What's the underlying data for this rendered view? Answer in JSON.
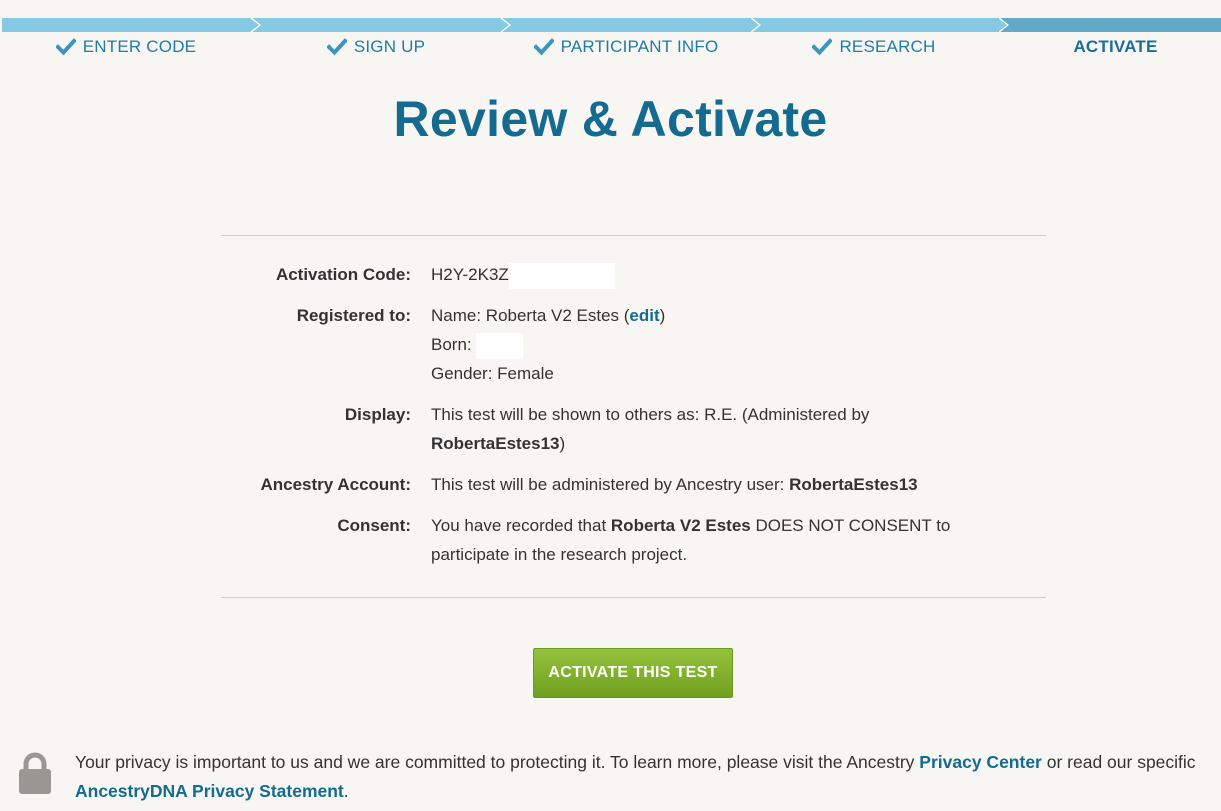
{
  "steps": [
    {
      "label": "ENTER CODE",
      "state": "complete"
    },
    {
      "label": "SIGN UP",
      "state": "complete"
    },
    {
      "label": "PARTICIPANT INFO",
      "state": "complete"
    },
    {
      "label": "RESEARCH",
      "state": "complete"
    },
    {
      "label": "ACTIVATE",
      "state": "active"
    }
  ],
  "page_title": "Review & Activate",
  "summary": {
    "activation_code": {
      "key": "Activation Code:",
      "value": "H2Y-2K3Z"
    },
    "registered": {
      "key": "Registered to:",
      "name_prefix": "Name: Roberta V2 Estes (",
      "edit_link": "edit",
      "name_suffix": ")",
      "born_label": "Born:",
      "gender": "Gender: Female"
    },
    "display": {
      "key": "Display:",
      "text": "This test will be shown to others as: R.E. (Administered by",
      "username": "RobertaEstes13",
      "close": ")"
    },
    "account": {
      "key": "Ancestry Account:",
      "text": "This test will be administered by Ancestry user: ",
      "username": "RobertaEstes13"
    },
    "consent": {
      "key": "Consent:",
      "prefix": "You have recorded that ",
      "name": "Roberta V2 Estes",
      "suffix": " DOES NOT CONSENT to participate in the research project."
    }
  },
  "activate_button": "ACTIVATE THIS TEST",
  "privacy": {
    "text_1": "Your privacy is important to us and we are committed to protecting it. To learn more, please visit the Ancestry ",
    "link_1": "Privacy Center",
    "text_2": " or read our specific ",
    "link_2": "AncestryDNA Privacy Statement",
    "text_3": "."
  },
  "colors": {
    "accent": "#146b8f",
    "step_bar": "#86c9e3",
    "step_bar_active": "#62a9c7",
    "button_green": "#7fae2a",
    "background": "#f7f6f3"
  },
  "icons": [
    "check-icon",
    "lock-icon"
  ]
}
